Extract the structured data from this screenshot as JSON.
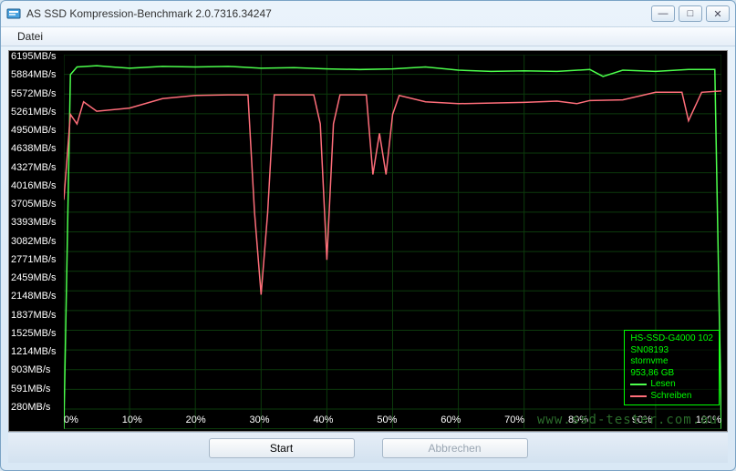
{
  "window": {
    "title": "AS SSD Kompression-Benchmark 2.0.7316.34247",
    "min_glyph": "—",
    "max_glyph": "□",
    "close_glyph": "✕"
  },
  "menu": {
    "datei": "Datei"
  },
  "buttons": {
    "start": "Start",
    "abort": "Abbrechen"
  },
  "watermark": "www.ssd-tester.com.au",
  "legend": {
    "device": "HS-SSD-G4000 102",
    "serial": "SN08193",
    "driver": "stornvme",
    "capacity": "953,86 GB",
    "read": "Lesen",
    "write": "Schreiben",
    "read_color": "#4cff4c",
    "write_color": "#ff6e7a"
  },
  "chart_data": {
    "type": "line",
    "xlabel": "",
    "ylabel": "MB/s",
    "x_ticks": [
      "0%",
      "10%",
      "20%",
      "30%",
      "40%",
      "50%",
      "60%",
      "70%",
      "80%",
      "90%",
      "100%"
    ],
    "y_ticks_mb_s": [
      6195,
      5884,
      5572,
      5261,
      4950,
      4638,
      4327,
      4016,
      3705,
      3393,
      3082,
      2771,
      2459,
      2148,
      1837,
      1525,
      1214,
      903,
      591,
      280
    ],
    "y_unit_suffix": "MB/s",
    "xlim": [
      0,
      100
    ],
    "ylim": [
      280,
      6195
    ],
    "series": [
      {
        "name": "Lesen",
        "color": "#4cff4c",
        "x": [
          0,
          1,
          2,
          5,
          10,
          15,
          20,
          25,
          30,
          35,
          40,
          45,
          50,
          55,
          60,
          65,
          70,
          75,
          80,
          82,
          85,
          90,
          95,
          99,
          100
        ],
        "y": [
          280,
          5880,
          6000,
          6020,
          5980,
          6010,
          6000,
          6010,
          5980,
          5990,
          5970,
          5960,
          5970,
          6000,
          5950,
          5930,
          5940,
          5930,
          5960,
          5850,
          5950,
          5930,
          5960,
          5960,
          280
        ]
      },
      {
        "name": "Schreiben",
        "color": "#ff6e7a",
        "x": [
          0,
          1,
          2,
          3,
          5,
          10,
          15,
          20,
          25,
          28,
          29,
          30,
          31,
          32,
          35,
          38,
          39,
          40,
          41,
          42,
          44,
          46,
          47,
          48,
          49,
          50,
          51,
          55,
          60,
          65,
          70,
          75,
          78,
          80,
          85,
          90,
          94,
          95,
          97,
          100
        ],
        "y": [
          3900,
          5250,
          5100,
          5450,
          5300,
          5350,
          5500,
          5550,
          5560,
          5560,
          3700,
          2400,
          3700,
          5560,
          5560,
          5560,
          5100,
          2950,
          5100,
          5560,
          5560,
          5560,
          4300,
          4950,
          4300,
          5250,
          5550,
          5450,
          5420,
          5430,
          5440,
          5460,
          5420,
          5470,
          5480,
          5600,
          5600,
          5150,
          5600,
          5620
        ]
      }
    ]
  }
}
